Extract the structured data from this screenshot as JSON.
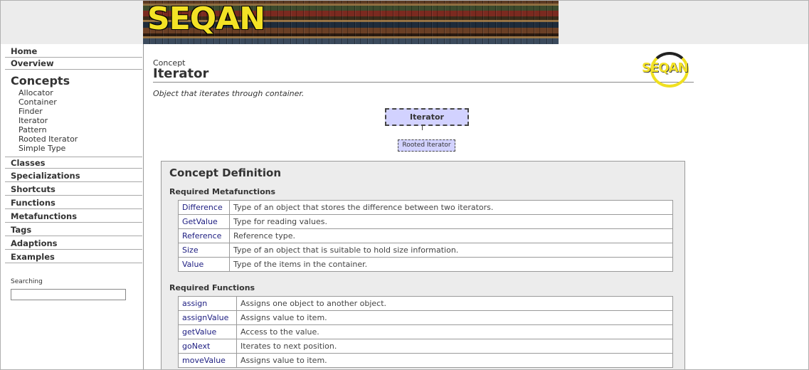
{
  "banner": {
    "logo_text": "SEQAN"
  },
  "sidebar": {
    "top_items": [
      {
        "label": "Home"
      },
      {
        "label": "Overview"
      }
    ],
    "heading": "Concepts",
    "sub_items": [
      {
        "label": "Allocator"
      },
      {
        "label": "Container"
      },
      {
        "label": "Finder"
      },
      {
        "label": "Iterator"
      },
      {
        "label": "Pattern"
      },
      {
        "label": "Rooted Iterator"
      },
      {
        "label": "Simple Type"
      }
    ],
    "bottom_items": [
      {
        "label": "Classes"
      },
      {
        "label": "Specializations"
      },
      {
        "label": "Shortcuts"
      },
      {
        "label": "Functions"
      },
      {
        "label": "Metafunctions"
      },
      {
        "label": "Tags"
      },
      {
        "label": "Adaptions"
      },
      {
        "label": "Examples"
      }
    ],
    "search": {
      "label": "Searching",
      "value": ""
    }
  },
  "main": {
    "kind": "Concept",
    "title": "Iterator",
    "logo_text": "SEQAN",
    "summary": "Object that iterates through container.",
    "diagram": {
      "main": "Iterator",
      "child": "Rooted Iterator"
    },
    "definition": {
      "title": "Concept Definition",
      "metafunctions_title": "Required Metafunctions",
      "metafunctions": [
        {
          "name": "Difference",
          "desc": "Type of an object that stores the difference between two iterators."
        },
        {
          "name": "GetValue",
          "desc": "Type for reading values."
        },
        {
          "name": "Reference",
          "desc": "Reference type."
        },
        {
          "name": "Size",
          "desc": "Type of an object that is suitable to hold size information."
        },
        {
          "name": "Value",
          "desc": "Type of the items in the container."
        }
      ],
      "functions_title": "Required Functions",
      "functions": [
        {
          "name": "assign",
          "desc": "Assigns one object to another object."
        },
        {
          "name": "assignValue",
          "desc": "Assigns value to item."
        },
        {
          "name": "getValue",
          "desc": "Access to the value."
        },
        {
          "name": "goNext",
          "desc": "Iterates to next position."
        },
        {
          "name": "moveValue",
          "desc": "Assigns value to item."
        }
      ]
    }
  },
  "colors": {
    "link": "#1c1c80",
    "diagram_fill": "#d2d2ff",
    "logo_yellow": "#f3e225"
  }
}
